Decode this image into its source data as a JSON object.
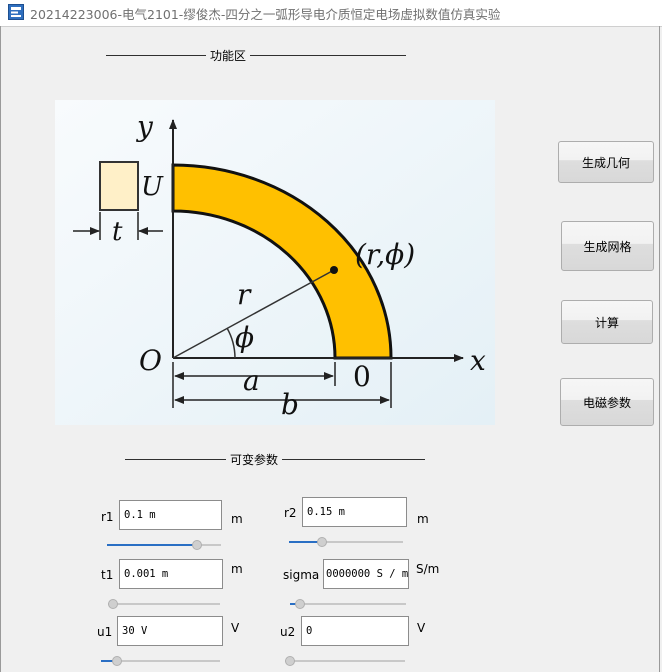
{
  "window": {
    "title": "20214223006-电气2101-缪俊杰-四分之一弧形导电介质恒定电场虚拟数值仿真实验"
  },
  "function_group": {
    "label": "功能区"
  },
  "params_group": {
    "label": "可变参数"
  },
  "buttons": {
    "generate_geometry": "生成几何",
    "generate_mesh": "生成网格",
    "compute": "计算",
    "em_params": "电磁参数"
  },
  "diagram": {
    "y_axis": "y",
    "x_axis": "x",
    "origin": "O",
    "u_label": "U",
    "t_label": "t",
    "r_label": "r",
    "phi_label": "ϕ",
    "point_label": "(r,ϕ)",
    "a_label": "a",
    "b_label": "b",
    "zero_label": "0",
    "fill_color": "#ffc000",
    "box_color": "#fff0c8"
  },
  "params": {
    "r1": {
      "label": "r1",
      "value": "0.1 m",
      "unit": "m",
      "slider_fraction": 0.82
    },
    "r2": {
      "label": "r2",
      "value": "0.15 m",
      "unit": "m",
      "slider_fraction": 0.27
    },
    "t1": {
      "label": "t1",
      "value": "0.001 m",
      "unit": "m",
      "slider_fraction": 0.0
    },
    "sigma": {
      "label": "sigma",
      "value": "0000000 S / m",
      "unit": "S/m",
      "slider_fraction": 0.05
    },
    "u1": {
      "label": "u1",
      "value": "30 V",
      "unit": "V",
      "slider_fraction": 0.1
    },
    "u2": {
      "label": "u2",
      "value": "0",
      "unit": "V",
      "slider_fraction": 0.0
    }
  },
  "colors": {
    "accent": "#2a6fc4"
  }
}
